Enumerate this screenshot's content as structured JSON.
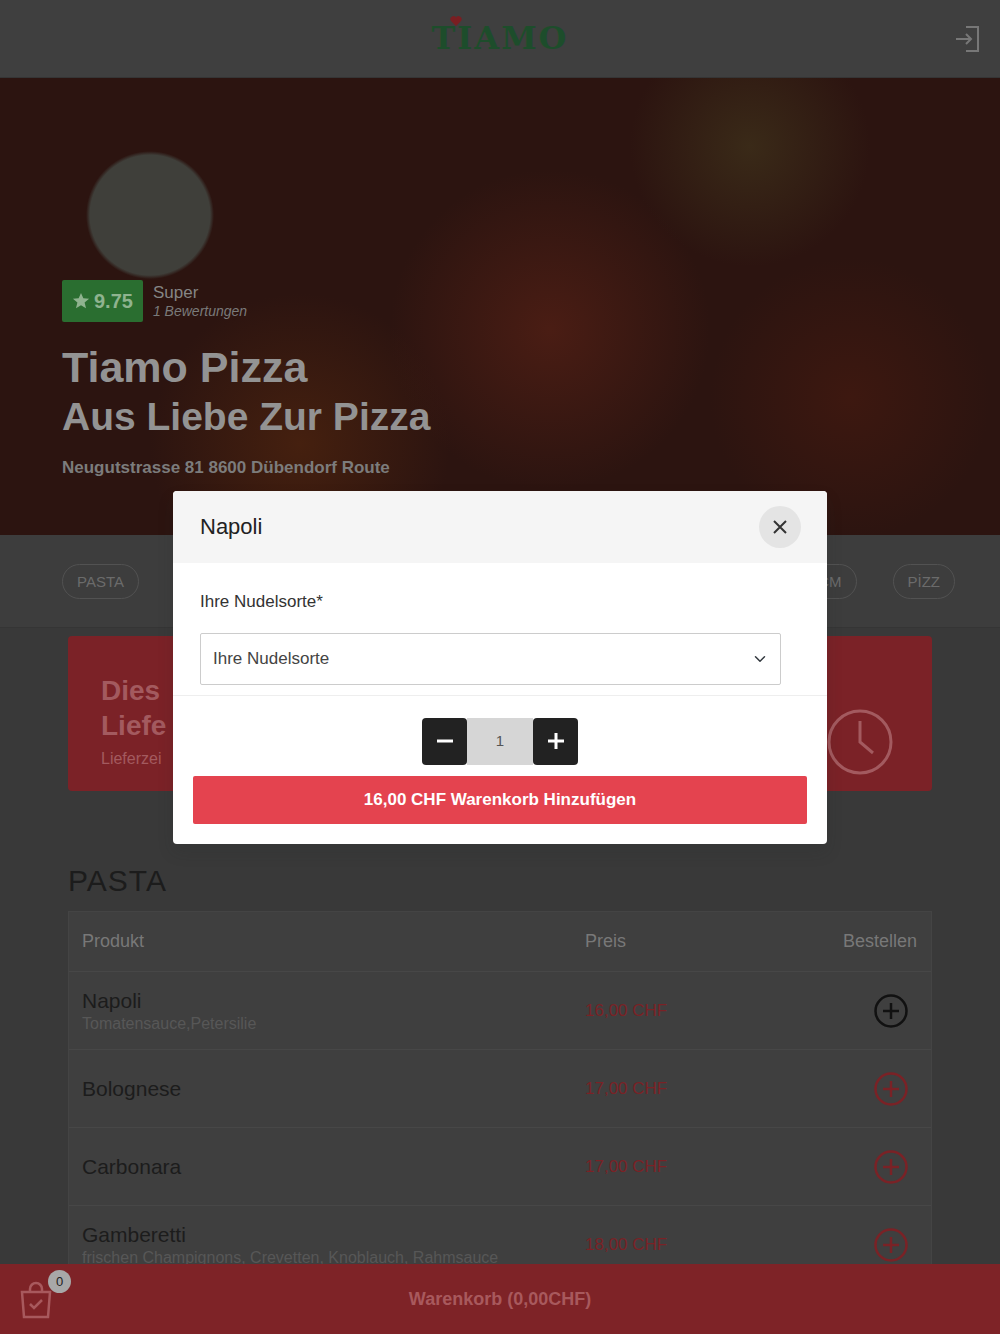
{
  "header": {
    "logo": "TIAMO"
  },
  "hero": {
    "rating": "9.75",
    "rating_label": "Super",
    "reviews": "1 Bewertungen",
    "title": "Tiamo Pizza",
    "subtitle": "Aus Liebe Zur Pizza",
    "address": "Neugutstrasse 81 8600 Dübendorf Route"
  },
  "categories": [
    {
      "label": "PASTA",
      "selected": false
    },
    {
      "label": "CM",
      "selected": false
    },
    {
      "label": "PİZZ",
      "selected": false
    }
  ],
  "banner": {
    "title_lines": [
      "Dies",
      "Liefe"
    ],
    "subtitle": "Lieferzei"
  },
  "section": {
    "title": "PASTA",
    "columns": [
      "Produkt",
      "Preis",
      "Bestellen"
    ],
    "rows": [
      {
        "name": "Napoli",
        "description": "Tomatensauce,Petersilie",
        "price": "16,00 CHF",
        "selected": true
      },
      {
        "name": "Bolognese",
        "price": "17,00 CHF",
        "selected": false
      },
      {
        "name": "Carbonara",
        "price": "17,00 CHF",
        "selected": false
      },
      {
        "name": "Gamberetti",
        "description": "frischen Champignons, Crevetten, Knoblauch, Rahmsauce",
        "price": "18,00 CHF",
        "selected": false
      }
    ]
  },
  "cart_bar": {
    "count": "0",
    "label": "Warenkorb (0,00CHF)"
  },
  "modal": {
    "title": "Napoli",
    "field_label": "Ihre Nudelsorte*",
    "select_placeholder": "Ihre Nudelsorte",
    "quantity": "1",
    "add_button": "16,00 CHF Warenkorb Hinzufügen"
  }
}
